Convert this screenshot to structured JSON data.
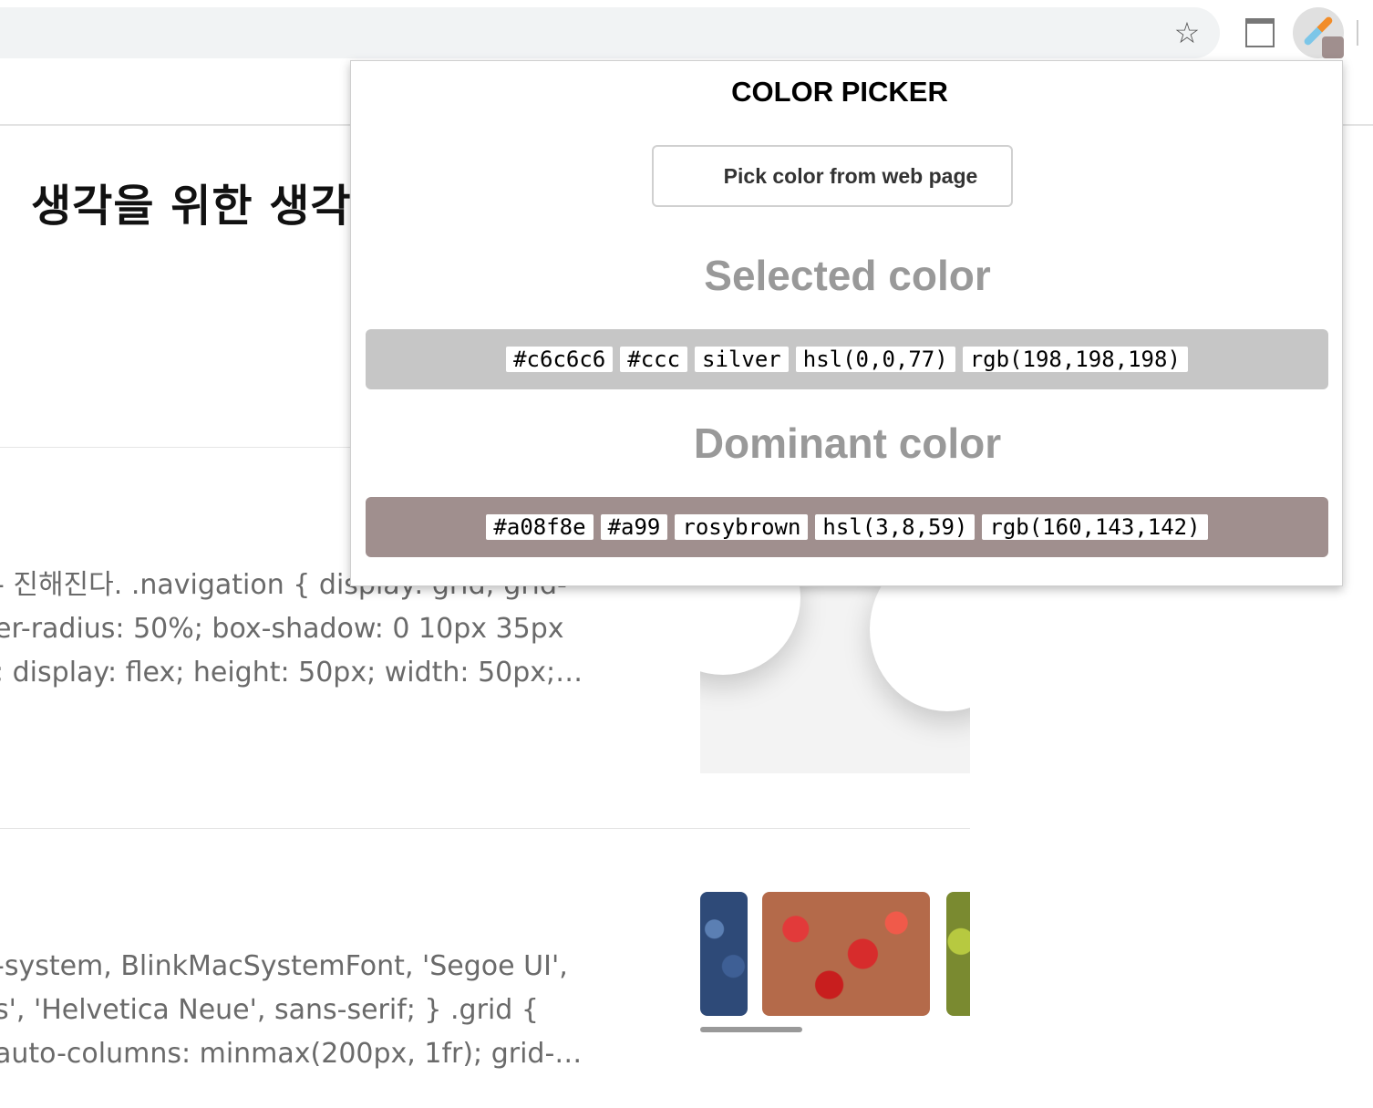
{
  "page": {
    "title": "생각을 위한 생각",
    "excerpt1": [
      "- 진해진다. .navigation { display: grid; grid-",
      "er-radius: 50%; box-shadow: 0 10px 35px",
      "; display: flex; height: 50px; width: 50px;…"
    ],
    "excerpt2": [
      "-system, BlinkMacSystemFont, 'Segoe UI',",
      "s', 'Helvetica Neue', sans-serif; } .grid {",
      "auto-columns: minmax(200px, 1fr); grid-…"
    ]
  },
  "toolbar": {
    "star_glyph": "☆"
  },
  "popup": {
    "title": "COLOR PICKER",
    "pick_button": "Pick color from web page",
    "selected": {
      "heading": "Selected color",
      "color": "#c6c6c6",
      "values": [
        "#c6c6c6",
        "#ccc",
        "silver",
        "hsl(0,0,77)",
        "rgb(198,198,198)"
      ]
    },
    "dominant": {
      "heading": "Dominant color",
      "color": "#a08f8e",
      "values": [
        "#a08f8e",
        "#a99",
        "rosybrown",
        "hsl(3,8,59)",
        "rgb(160,143,142)"
      ]
    }
  },
  "icons": {
    "star": "star-icon",
    "tab": "tab-window-icon",
    "extension": "eyedropper-icon"
  }
}
